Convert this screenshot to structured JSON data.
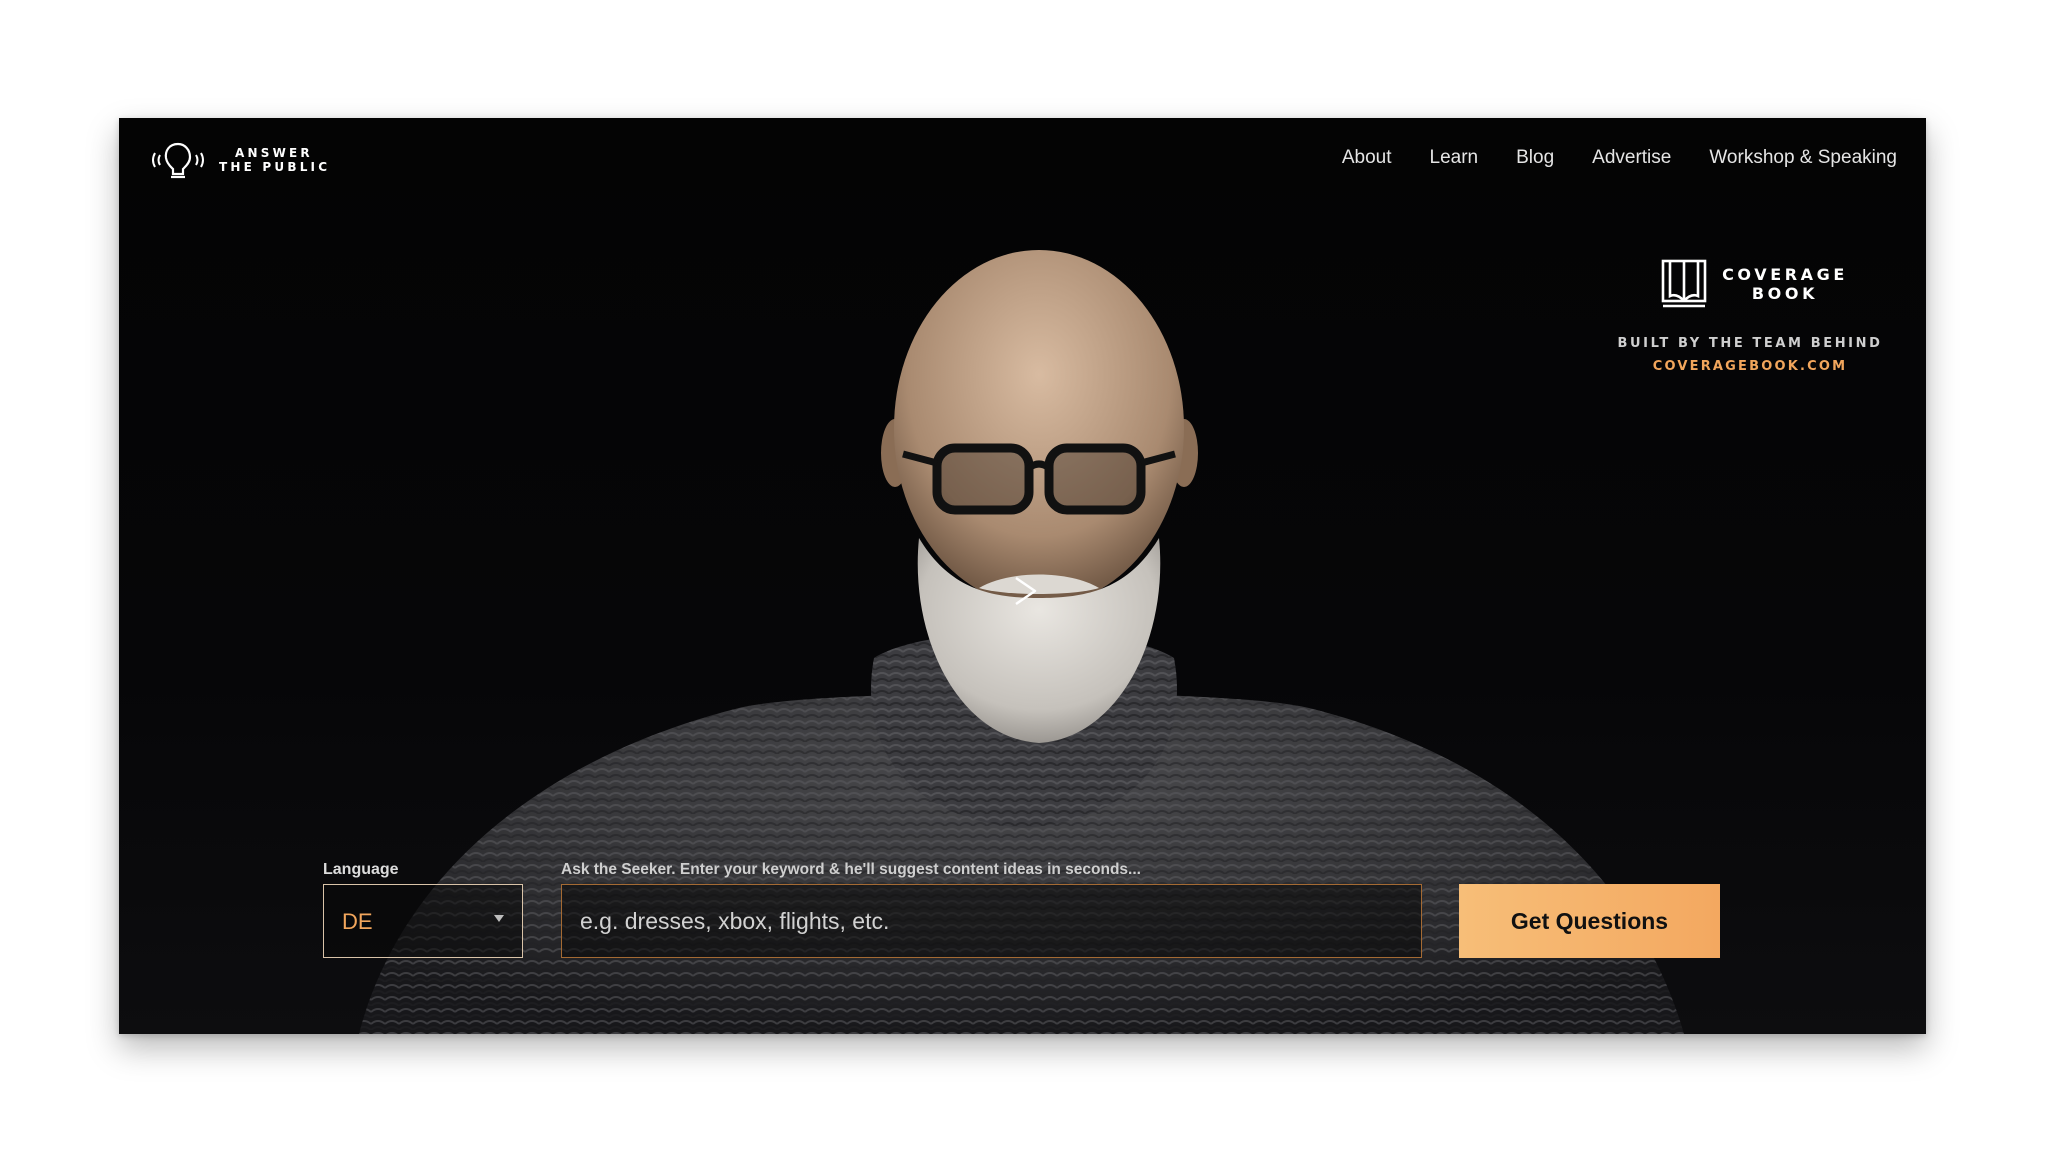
{
  "header": {
    "logo": {
      "line1": "ANSWER",
      "line2": "THE PUBLIC",
      "icon": "seeker-head-icon"
    },
    "nav": [
      {
        "label": "About"
      },
      {
        "label": "Learn"
      },
      {
        "label": "Blog"
      },
      {
        "label": "Advertise"
      },
      {
        "label": "Workshop & Speaking"
      }
    ]
  },
  "promo": {
    "icon": "open-book-icon",
    "name_line1": "COVERAGE",
    "name_line2": "BOOK",
    "tagline": "BUILT BY THE TEAM BEHIND",
    "link": "COVERAGEBOOK.COM"
  },
  "hero": {
    "play_icon": "chevron-right-icon"
  },
  "search": {
    "language_label": "Language",
    "language_value": "DE",
    "keyword_label": "Ask the Seeker. Enter your keyword & he'll suggest content ideas in seconds...",
    "keyword_placeholder": "e.g. dresses, xbox, flights, etc.",
    "submit_label": "Get Questions"
  },
  "colors": {
    "accent": "#f2a65c",
    "button": "#f5b26b",
    "background": "#050505"
  }
}
